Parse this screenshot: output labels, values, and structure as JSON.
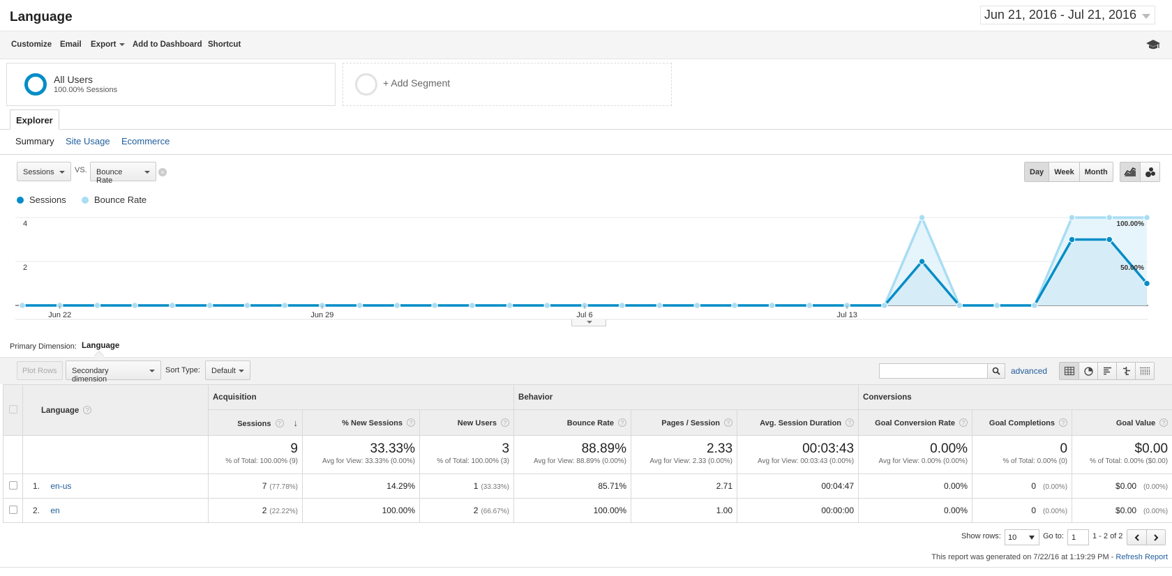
{
  "header": {
    "title": "Language",
    "date_range": "Jun 21, 2016 - Jul 21, 2016"
  },
  "toolbar": {
    "customize": "Customize",
    "email": "Email",
    "export": "Export",
    "add_to_dashboard": "Add to Dashboard",
    "shortcut": "Shortcut"
  },
  "segments": {
    "active_name": "All Users",
    "active_detail": "100.00% Sessions",
    "add_label": "+ Add Segment"
  },
  "explorer": {
    "tab": "Explorer",
    "subtabs": [
      "Summary",
      "Site Usage",
      "Ecommerce"
    ]
  },
  "chart_controls": {
    "metric1": "Sessions",
    "vs": "VS.",
    "metric2": "Bounce Rate",
    "granularity": [
      "Day",
      "Week",
      "Month"
    ],
    "active_granularity": "Day"
  },
  "chart_data": {
    "type": "line",
    "x": [
      "Jun 21",
      "Jun 22",
      "Jun 23",
      "Jun 24",
      "Jun 25",
      "Jun 26",
      "Jun 27",
      "Jun 28",
      "Jun 29",
      "Jun 30",
      "Jul 1",
      "Jul 2",
      "Jul 3",
      "Jul 4",
      "Jul 5",
      "Jul 6",
      "Jul 7",
      "Jul 8",
      "Jul 9",
      "Jul 10",
      "Jul 11",
      "Jul 12",
      "Jul 13",
      "Jul 14",
      "Jul 15",
      "Jul 16",
      "Jul 17",
      "Jul 18",
      "Jul 19",
      "Jul 20",
      "Jul 21"
    ],
    "x_tick_labels": [
      "Jun 22",
      "Jun 29",
      "Jul 6",
      "Jul 13"
    ],
    "series": [
      {
        "name": "Sessions",
        "axis": "left",
        "color": "#058dc7",
        "values": [
          0,
          0,
          0,
          0,
          0,
          0,
          0,
          0,
          0,
          0,
          0,
          0,
          0,
          0,
          0,
          0,
          0,
          0,
          0,
          0,
          0,
          0,
          0,
          0,
          2,
          0,
          0,
          0,
          3,
          3,
          1
        ]
      },
      {
        "name": "Bounce Rate",
        "axis": "right",
        "color": "#a9ddf3",
        "values": [
          0,
          0,
          0,
          0,
          0,
          0,
          0,
          0,
          0,
          0,
          0,
          0,
          0,
          0,
          0,
          0,
          0,
          0,
          0,
          0,
          0,
          0,
          0,
          0,
          100,
          0,
          0,
          0,
          100,
          100,
          100
        ]
      }
    ],
    "left_axis": {
      "ticks": [
        "2",
        "4"
      ],
      "ylim": [
        0,
        4
      ]
    },
    "right_axis": {
      "ticks": [
        "50.00%",
        "100.00%"
      ],
      "ylim": [
        0,
        100
      ]
    },
    "grid": true,
    "legend": "top-left"
  },
  "table_controls": {
    "primary_dimension_label": "Primary Dimension:",
    "primary_dimension": "Language",
    "plot_rows": "Plot Rows",
    "secondary_dimension": "Secondary dimension",
    "sort_type_label": "Sort Type:",
    "sort_type": "Default",
    "search_placeholder": "",
    "advanced": "advanced"
  },
  "table": {
    "dimension_header": "Language",
    "groups": [
      "Acquisition",
      "Behavior",
      "Conversions"
    ],
    "columns": [
      "Sessions",
      "% New Sessions",
      "New Users",
      "Bounce Rate",
      "Pages / Session",
      "Avg. Session Duration",
      "Goal Conversion Rate",
      "Goal Completions",
      "Goal Value"
    ],
    "totals": [
      {
        "value": "9",
        "detail": "% of Total: 100.00% (9)"
      },
      {
        "value": "33.33%",
        "detail": "Avg for View: 33.33% (0.00%)"
      },
      {
        "value": "3",
        "detail": "% of Total: 100.00% (3)"
      },
      {
        "value": "88.89%",
        "detail": "Avg for View: 88.89% (0.00%)"
      },
      {
        "value": "2.33",
        "detail": "Avg for View: 2.33 (0.00%)"
      },
      {
        "value": "00:03:43",
        "detail": "Avg for View: 00:03:43 (0.00%)"
      },
      {
        "value": "0.00%",
        "detail": "Avg for View: 0.00% (0.00%)"
      },
      {
        "value": "0",
        "detail": "% of Total: 0.00% (0)"
      },
      {
        "value": "$0.00",
        "detail": "% of Total: 0.00% ($0.00)"
      }
    ],
    "rows": [
      {
        "index": "1.",
        "language": "en-us",
        "sessions": "7",
        "sessions_pct": "(77.78%)",
        "new_sessions": "14.29%",
        "new_users": "1",
        "new_users_pct": "(33.33%)",
        "bounce": "85.71%",
        "pages": "2.71",
        "duration": "00:04:47",
        "conv_rate": "0.00%",
        "completions": "0",
        "completions_pct": "(0.00%)",
        "value": "$0.00",
        "value_pct": "(0.00%)"
      },
      {
        "index": "2.",
        "language": "en",
        "sessions": "2",
        "sessions_pct": "(22.22%)",
        "new_sessions": "100.00%",
        "new_users": "2",
        "new_users_pct": "(66.67%)",
        "bounce": "100.00%",
        "pages": "1.00",
        "duration": "00:00:00",
        "conv_rate": "0.00%",
        "completions": "0",
        "completions_pct": "(0.00%)",
        "value": "$0.00",
        "value_pct": "(0.00%)"
      }
    ]
  },
  "pagination": {
    "show_rows_label": "Show rows:",
    "show_rows": "10",
    "goto_label": "Go to:",
    "goto": "1",
    "range": "1 - 2 of 2"
  },
  "footer": {
    "generated": "This report was generated on 7/22/16 at 1:19:29 PM - ",
    "refresh": "Refresh Report"
  }
}
